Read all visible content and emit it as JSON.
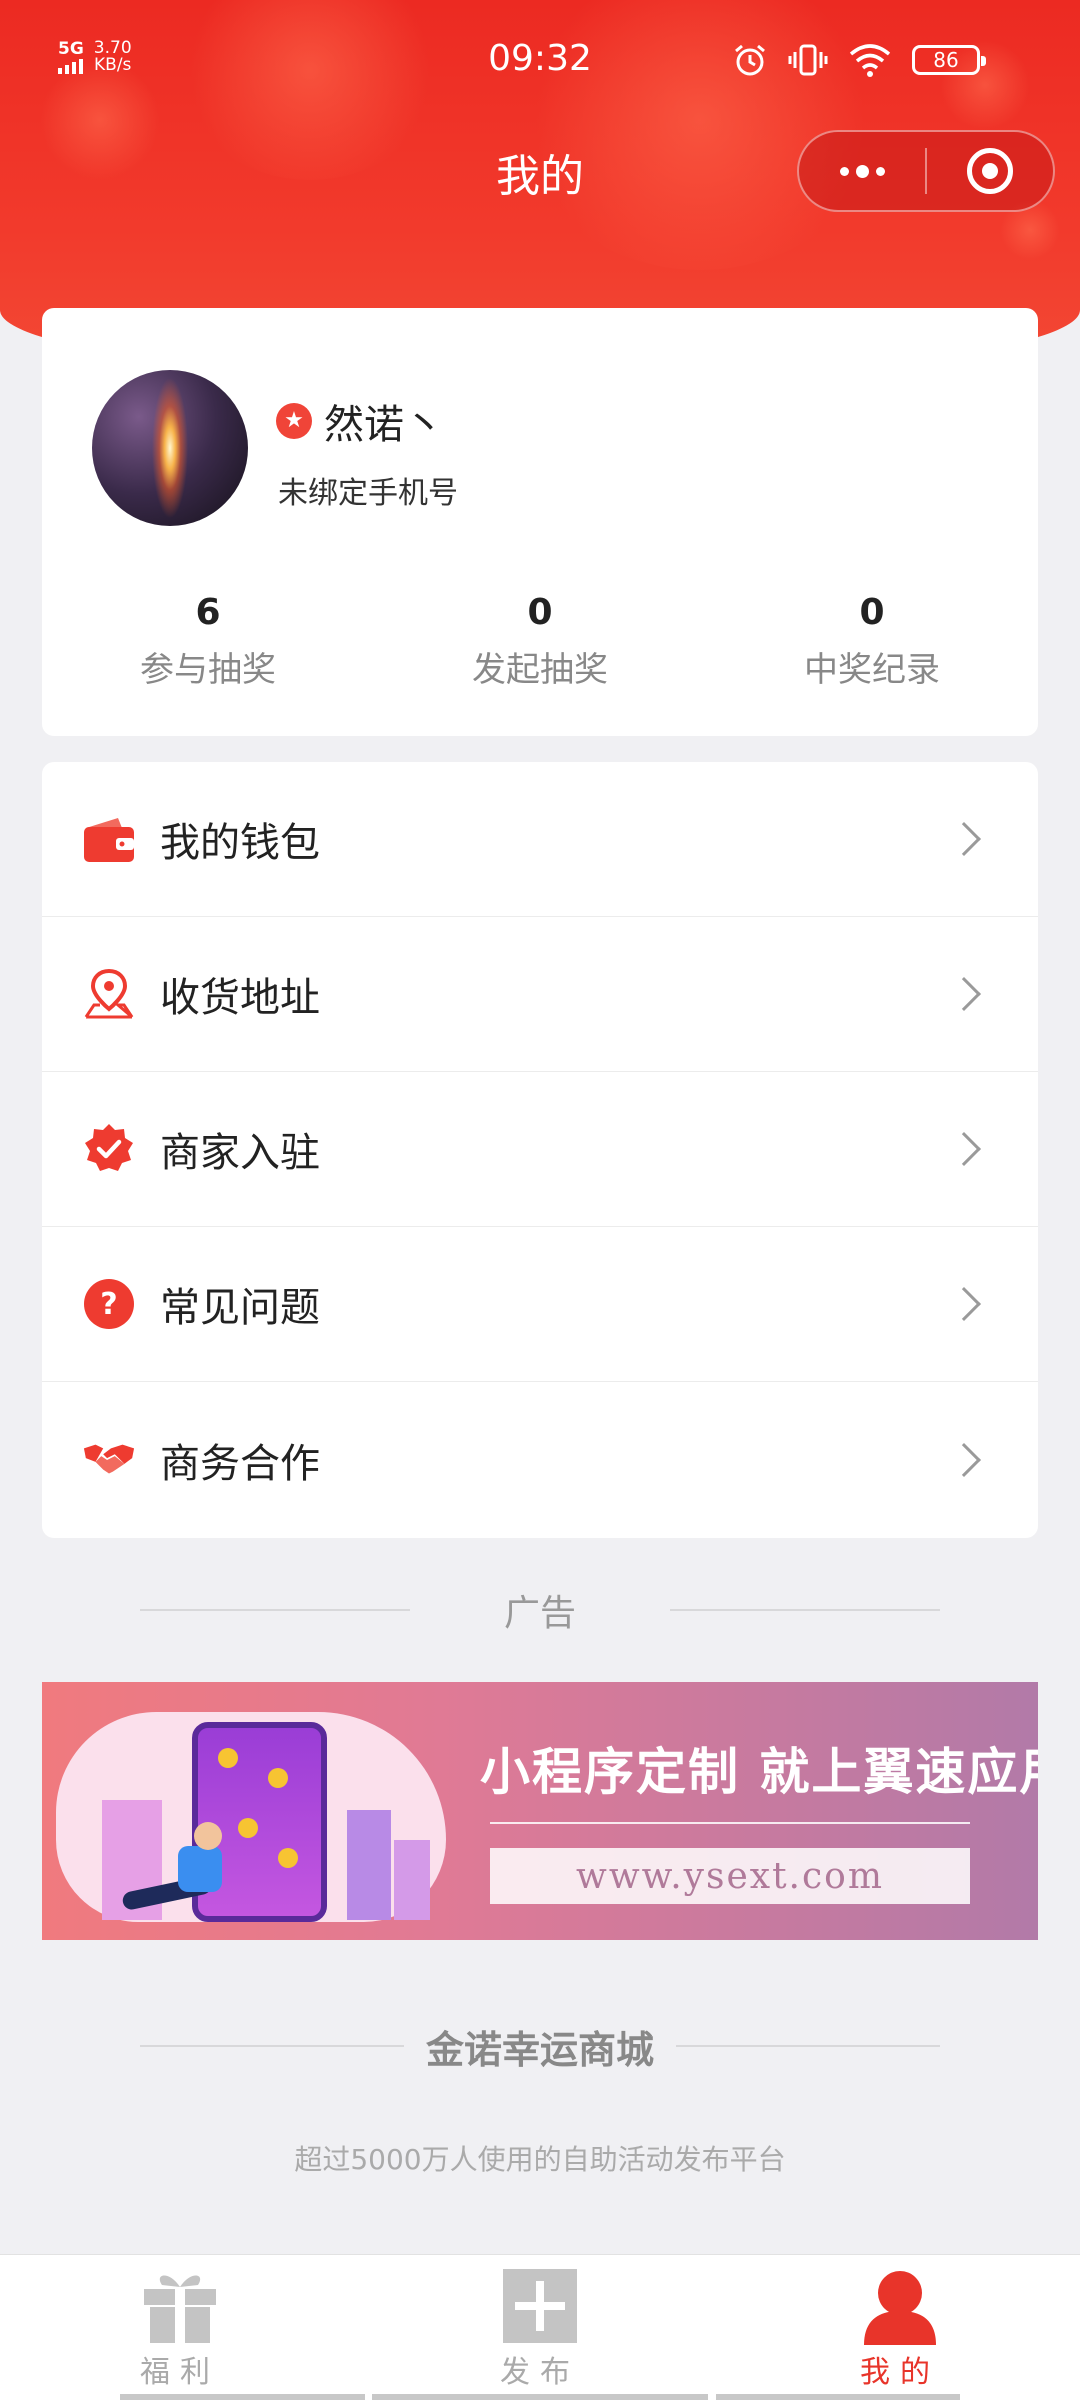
{
  "status_bar": {
    "network": "5G",
    "speed_value": "3.70",
    "speed_unit": "KB/s",
    "time": "09:32",
    "battery": "86"
  },
  "nav": {
    "title": "我的"
  },
  "profile": {
    "name": "然诺丶",
    "phone_status": "未绑定手机号",
    "stats": [
      {
        "value": "6",
        "label": "参与抽奖"
      },
      {
        "value": "0",
        "label": "发起抽奖"
      },
      {
        "value": "0",
        "label": "中奖纪录"
      }
    ]
  },
  "menu": [
    {
      "label": "我的钱包",
      "icon": "wallet-icon"
    },
    {
      "label": "收货地址",
      "icon": "location-pin-icon"
    },
    {
      "label": "商家入驻",
      "icon": "verified-badge-icon"
    },
    {
      "label": "常见问题",
      "icon": "question-icon"
    },
    {
      "label": "商务合作",
      "icon": "handshake-icon"
    }
  ],
  "ad": {
    "section_label": "广告",
    "headline": "小程序定制 就上翼速应用",
    "url": "www.ysext.com"
  },
  "footer": {
    "brand": "金诺幸运商城",
    "slogan": "超过5000万人使用的自助活动发布平台"
  },
  "tabbar": [
    {
      "label": "福利",
      "icon": "gift-icon",
      "active": false
    },
    {
      "label": "发布",
      "icon": "plus-icon",
      "active": false
    },
    {
      "label": "我的",
      "icon": "user-icon",
      "active": true
    }
  ],
  "colors": {
    "brand_red": "#e8342a",
    "header_red": "#ef3226",
    "background": "#f0f0f3",
    "tab_inactive": "#aaaaaa"
  }
}
